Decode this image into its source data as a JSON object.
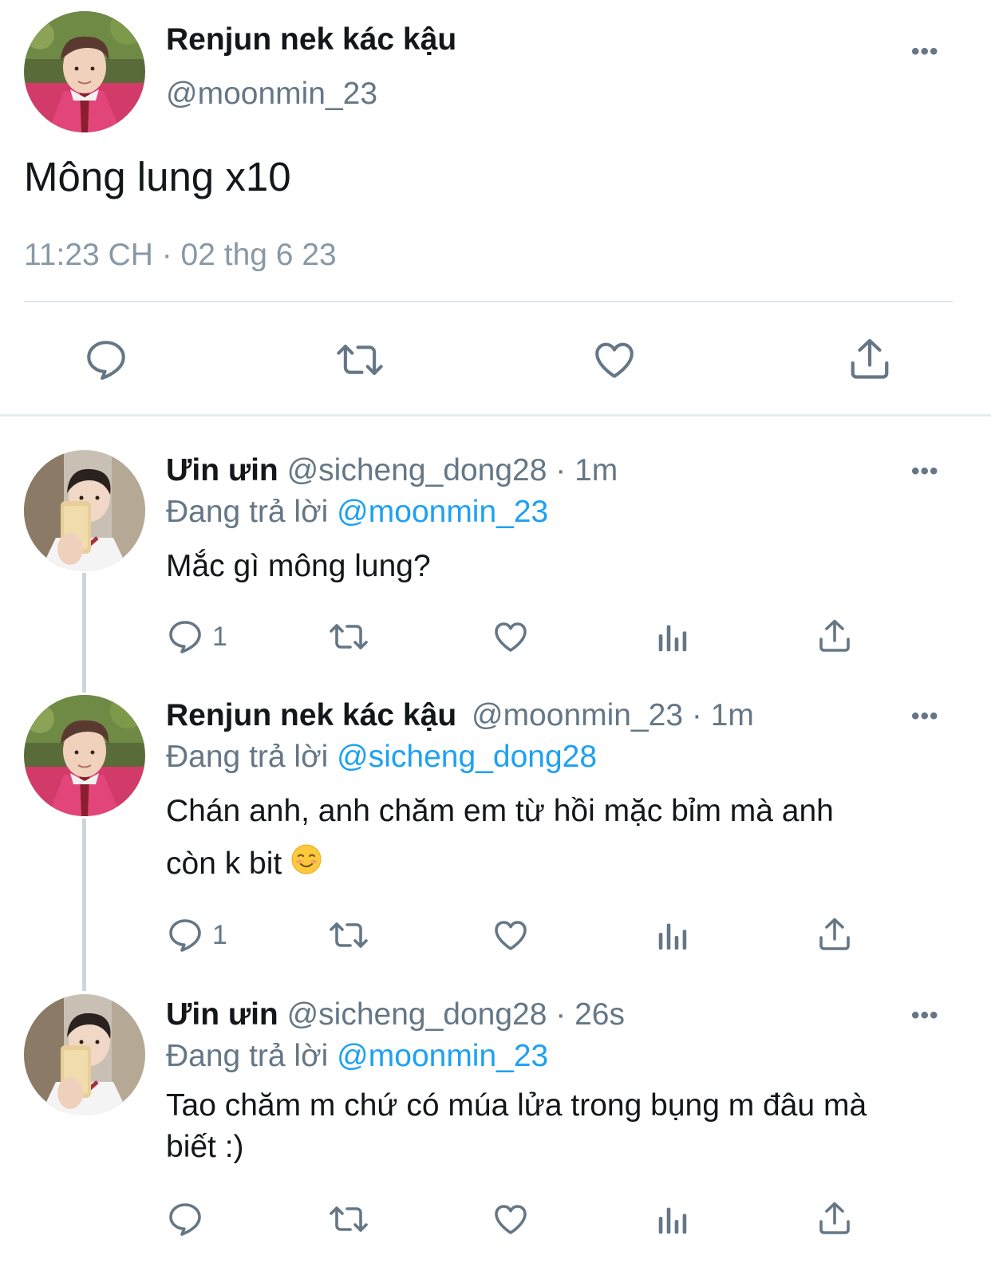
{
  "main_tweet": {
    "display_name": "Renjun nek kác kậu",
    "handle": "@moonmin_23",
    "more_label": "•••",
    "text": "Mông lung x10",
    "timestamp": "11:23 CH · 02 thg 6 23"
  },
  "replies": [
    {
      "display_name": "Ưin ưin",
      "meta": "@sicheng_dong28 · 1m",
      "replying_prefix": "Đang trả lời",
      "replying_to": "@moonmin_23",
      "text": "Mắc gì mông lung?",
      "reply_count": "1",
      "more_label": "•••"
    },
    {
      "display_name": "Renjun nek kác kậu",
      "meta": "@moonmin_23 · 1m",
      "replying_prefix": "Đang trả lời",
      "replying_to": "@sicheng_dong28",
      "text_line1": "Chán anh, anh chăm em từ hồi mặc bỉm mà anh",
      "text_line2": "còn k bit",
      "emoji_name": "smiling-face-icon",
      "reply_count": "1",
      "more_label": "•••"
    },
    {
      "display_name": "Ưin ưin",
      "meta": "@sicheng_dong28 · 26s",
      "replying_prefix": "Đang trả lời",
      "replying_to": "@moonmin_23",
      "text_line1": "Tao chăm m chứ có múa lửa trong bụng m đâu mà",
      "text_line2": "biết :)",
      "reply_count": "",
      "more_label": "•••"
    }
  ],
  "icons": {
    "reply": "reply-icon",
    "retweet": "retweet-icon",
    "like": "heart-icon",
    "analytics": "analytics-icon",
    "share": "share-icon",
    "more": "more-icon"
  },
  "colors": {
    "text": "#14171a",
    "secondary": "#657786",
    "link": "#1da1f2",
    "divider": "#e1e8ed"
  }
}
